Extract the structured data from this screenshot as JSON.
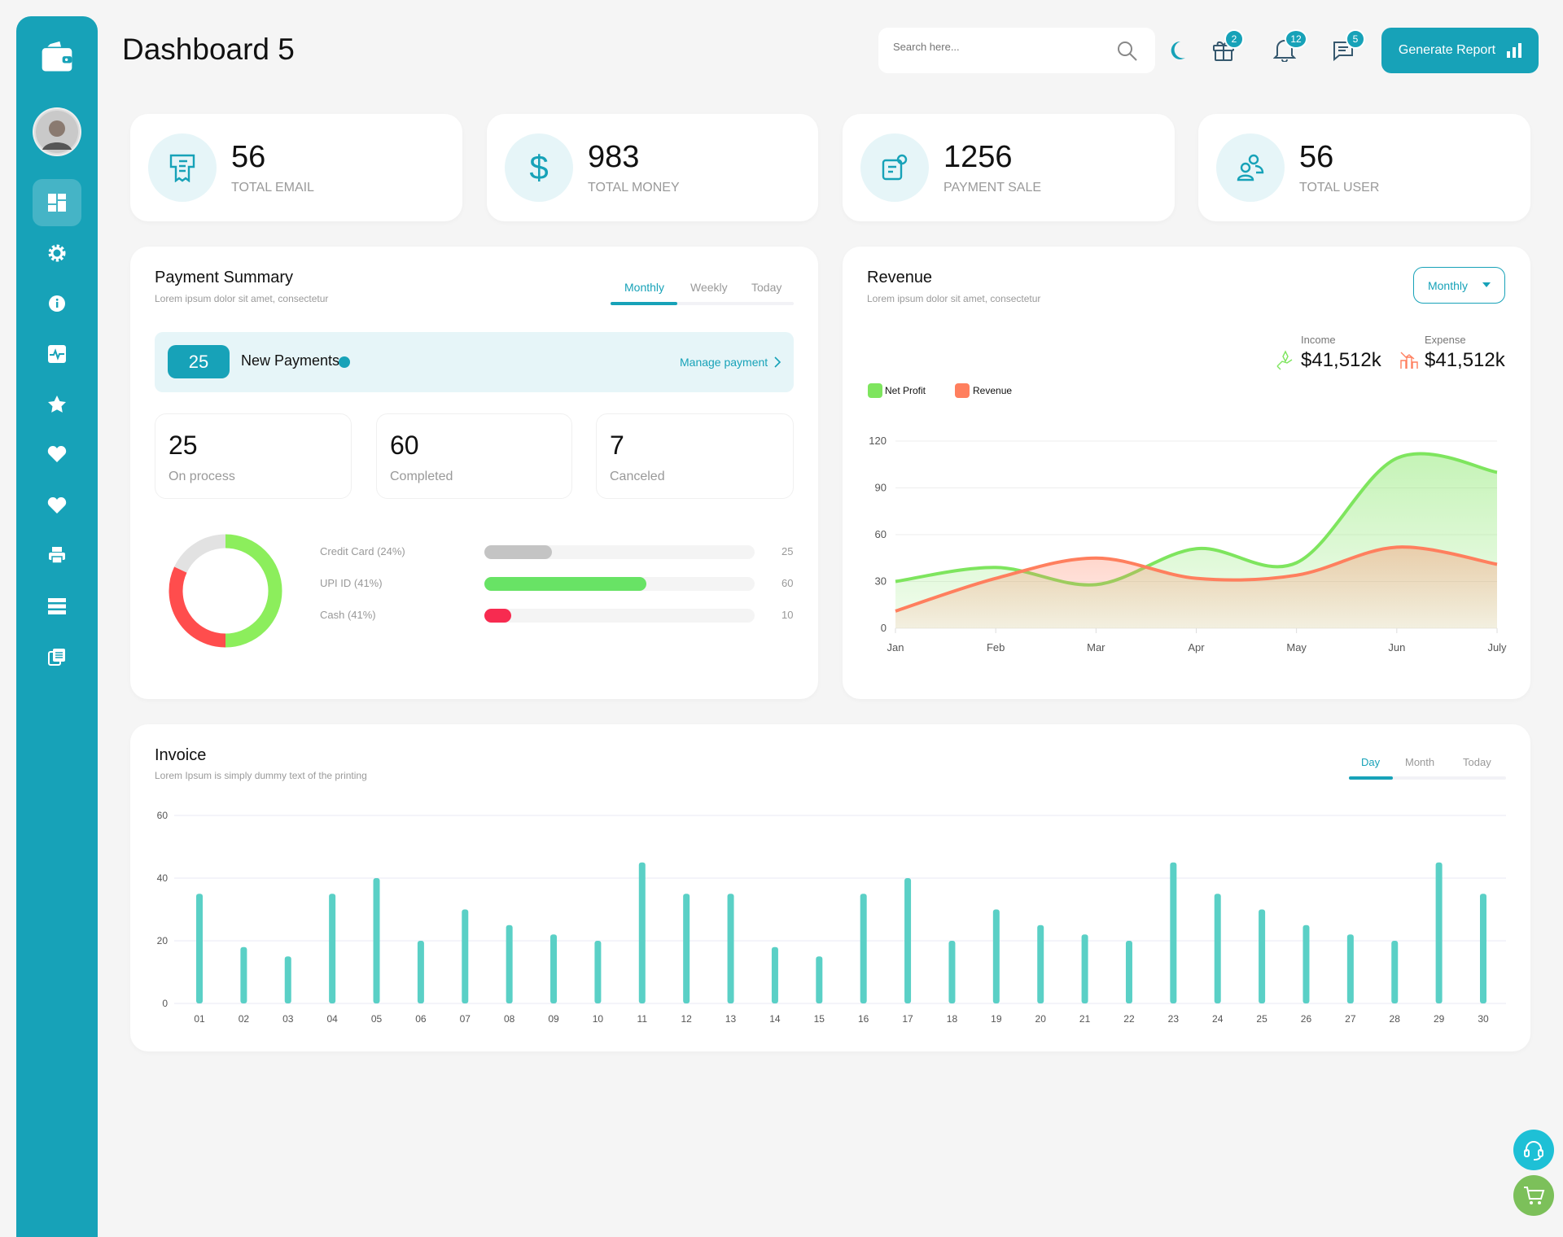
{
  "header": {
    "title": "Dashboard 5",
    "search_placeholder": "Search here...",
    "generate_label": "Generate Report",
    "badges": {
      "gift": "2",
      "bell": "12",
      "chat": "5"
    }
  },
  "sidebar": {
    "items": [
      "wallet-logo",
      "avatar",
      "dashboard",
      "settings",
      "info",
      "activity",
      "star",
      "heart",
      "heart",
      "printer",
      "list",
      "copy"
    ],
    "active": "dashboard"
  },
  "stats": [
    {
      "value": "56",
      "label": "TOTAL EMAIL",
      "icon": "receipt-icon"
    },
    {
      "value": "983",
      "label": "TOTAL MONEY",
      "icon": "dollar-icon"
    },
    {
      "value": "1256",
      "label": "PAYMENT SALE",
      "icon": "payment-icon"
    },
    {
      "value": "56",
      "label": "TOTAL USER",
      "icon": "users-icon"
    }
  ],
  "payment": {
    "title": "Payment Summary",
    "subtitle": "Lorem ipsum dolor sit amet, consectetur",
    "tabs": [
      "Monthly",
      "Weekly",
      "Today"
    ],
    "active_tab": "Monthly",
    "new_count": "25",
    "new_label": "New Payments",
    "manage_label": "Manage payment",
    "boxes": [
      {
        "value": "25",
        "label": "On process"
      },
      {
        "value": "60",
        "label": "Completed"
      },
      {
        "value": "7",
        "label": "Canceled"
      }
    ],
    "methods": [
      {
        "label": "Credit Card (24%)",
        "value": "25",
        "percent": 25,
        "color": "#c4c4c4"
      },
      {
        "label": "UPI ID (41%)",
        "value": "60",
        "percent": 60,
        "color": "#68e365"
      },
      {
        "label": "Cash (41%)",
        "value": "10",
        "percent": 10,
        "color": "#f72b50"
      }
    ],
    "donut": [
      {
        "share": 0.5,
        "color": "#8cee5c"
      },
      {
        "share": 0.32,
        "color": "#ff4d4d"
      },
      {
        "share": 0.18,
        "color": "#e2e2e2"
      }
    ]
  },
  "revenue": {
    "title": "Revenue",
    "subtitle": "Lorem ipsum dolor sit amet, consectetur",
    "dropdown": "Monthly",
    "income_label": "Income",
    "income_value": "$41,512k",
    "expense_label": "Expense",
    "expense_value": "$41,512k"
  },
  "chart_data": [
    {
      "type": "area",
      "categories": [
        "Jan",
        "Feb",
        "Mar",
        "Apr",
        "May",
        "Jun",
        "July"
      ],
      "yticks": [
        "0",
        "30",
        "60",
        "90",
        "120"
      ],
      "ylim": [
        0,
        120
      ],
      "grid": true,
      "legend": "top-left",
      "series": [
        {
          "name": "Net Profit",
          "color": "#7ee55e",
          "values": [
            30,
            39,
            28,
            51,
            42,
            109,
            100
          ]
        },
        {
          "name": "Revenue",
          "color": "#ff7f5e",
          "values": [
            11,
            32,
            45,
            32,
            34,
            52,
            41
          ]
        }
      ]
    },
    {
      "type": "bar",
      "title": "Invoice",
      "subtitle": "Lorem Ipsum is simply dummy text of the printing",
      "tabs": [
        "Day",
        "Month",
        "Today"
      ],
      "active_tab": "Day",
      "categories": [
        "01",
        "02",
        "03",
        "04",
        "05",
        "06",
        "07",
        "08",
        "09",
        "10",
        "11",
        "12",
        "13",
        "14",
        "15",
        "16",
        "17",
        "18",
        "19",
        "20",
        "21",
        "22",
        "23",
        "24",
        "25",
        "26",
        "27",
        "28",
        "29",
        "30"
      ],
      "values": [
        35,
        18,
        15,
        35,
        40,
        20,
        30,
        25,
        22,
        20,
        45,
        35,
        35,
        18,
        15,
        35,
        40,
        20,
        30,
        25,
        22,
        20,
        45,
        35,
        30,
        25,
        22,
        20,
        45,
        35
      ],
      "yticks": [
        "0",
        "20",
        "40",
        "60"
      ],
      "ylim": [
        0,
        60
      ],
      "grid": true,
      "color": "#5ad0c6"
    }
  ]
}
